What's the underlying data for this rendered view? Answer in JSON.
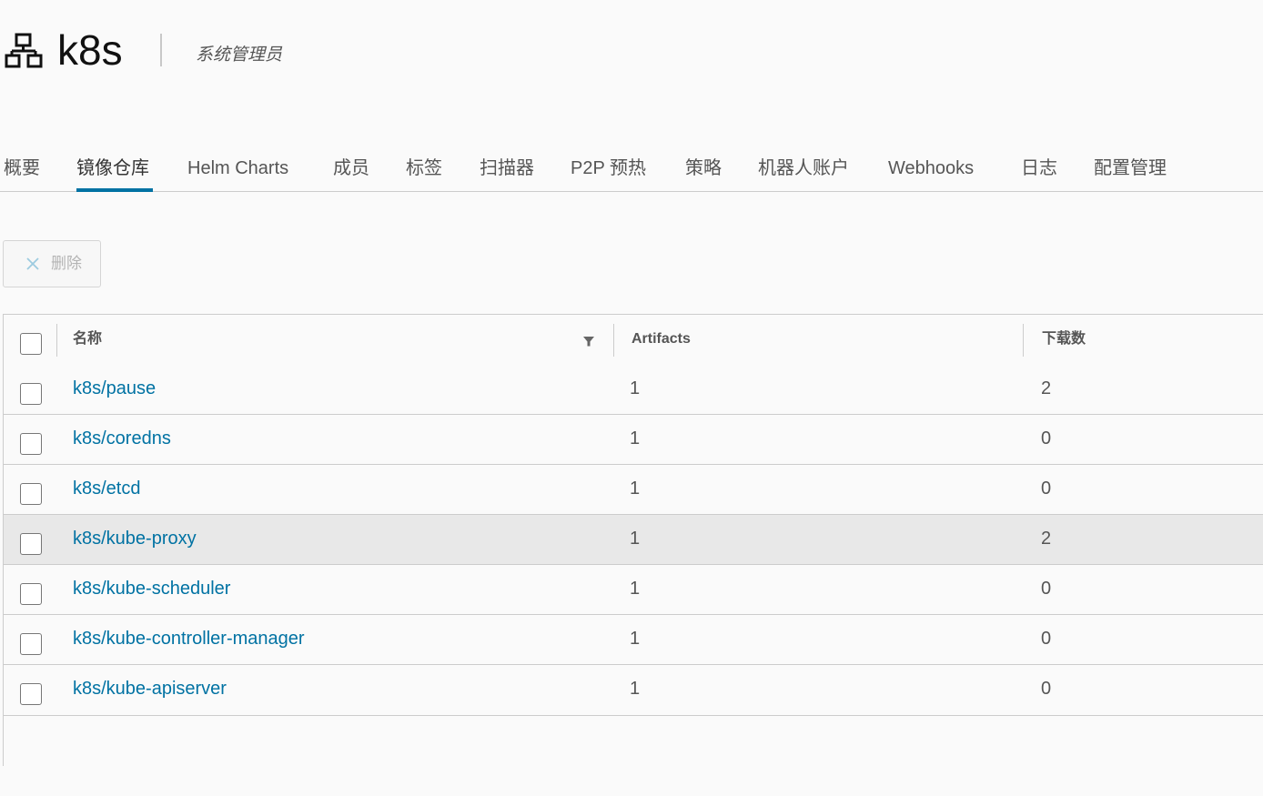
{
  "project": {
    "name": "k8s",
    "role": "系统管理员",
    "icon": "project-hierarchy-icon"
  },
  "tabs": [
    {
      "label": "概要"
    },
    {
      "label": "镜像仓库"
    },
    {
      "label": "Helm Charts"
    },
    {
      "label": "成员"
    },
    {
      "label": "标签"
    },
    {
      "label": "扫描器"
    },
    {
      "label": "P2P 预热"
    },
    {
      "label": "策略"
    },
    {
      "label": "机器人账户"
    },
    {
      "label": "Webhooks"
    },
    {
      "label": "日志"
    },
    {
      "label": "配置管理"
    }
  ],
  "active_tab": "镜像仓库",
  "toolbar": {
    "delete_label": "删除",
    "delete_icon": "close-icon"
  },
  "table": {
    "columns": [
      "名称",
      "Artifacts",
      "下载数"
    ],
    "rows": [
      {
        "name": "k8s/pause",
        "artifacts": "1",
        "downloads": "2"
      },
      {
        "name": "k8s/coredns",
        "artifacts": "1",
        "downloads": "0"
      },
      {
        "name": "k8s/etcd",
        "artifacts": "1",
        "downloads": "0"
      },
      {
        "name": "k8s/kube-proxy",
        "artifacts": "1",
        "downloads": "2"
      },
      {
        "name": "k8s/kube-scheduler",
        "artifacts": "1",
        "downloads": "0"
      },
      {
        "name": "k8s/kube-controller-manager",
        "artifacts": "1",
        "downloads": "0"
      },
      {
        "name": "k8s/kube-apiserver",
        "artifacts": "1",
        "downloads": "0"
      }
    ],
    "hovered_row": "k8s/kube-proxy"
  },
  "colors": {
    "accent": "#0072a3",
    "link": "#0072a3",
    "hover_row": "#e8e8e8",
    "background": "#fafafa"
  }
}
